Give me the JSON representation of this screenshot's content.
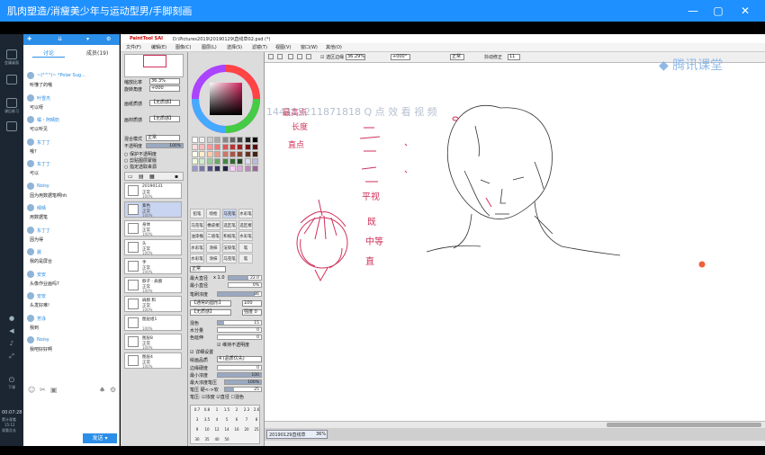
{
  "window": {
    "title": "肌肉塑造/消瘦美少年与运动型男/手脚刻画"
  },
  "sidenav": {
    "items": [
      "会議桌面",
      "",
      "",
      "课后练习",
      "",
      "",
      "",
      "",
      "下课"
    ],
    "time": "00:07:28",
    "time_label": "累计观看",
    "time_sub1": "15:12",
    "time_sub2": "观看总长"
  },
  "chat": {
    "tabs": [
      "讨论",
      "成员(19)"
    ],
    "messages": [
      {
        "name": "~(°^°)~ *Polar Sug...",
        "text": "听懂了的哦"
      },
      {
        "name": "叶雪杰",
        "text": "可以呀"
      },
      {
        "name": "橘・阿晴奶",
        "text": "可以听见"
      },
      {
        "name": "东丁丁",
        "text": "哦?"
      },
      {
        "name": "东丁丁",
        "text": "可以"
      },
      {
        "name": "Noisy",
        "text": "因为用数据笔啊hh"
      },
      {
        "name": "晴晴",
        "text": "用数据笔"
      },
      {
        "name": "东丁丁",
        "text": "因为得"
      },
      {
        "name": "晨",
        "text": "我的是屏台"
      },
      {
        "name": "安安",
        "text": "头像作业画吗?"
      },
      {
        "name": "安安",
        "text": "头发好难!"
      },
      {
        "name": "芳泳",
        "text": "我到"
      },
      {
        "name": "Noisy",
        "text": "我吧好好啊"
      }
    ],
    "send_label": "发送"
  },
  "sai": {
    "app_logo": "PaintTool SAI",
    "file_title": "D:\\Pictures2019\\20190129\\直线草02.psd (*)",
    "menus": [
      "文件(F)",
      "编辑(E)",
      "图像(C)",
      "图层(L)",
      "选择(S)",
      "滤镜(T)",
      "视图(V)",
      "窗口(W)",
      "其他(O)"
    ],
    "toolbar": {
      "anti_alias": "选区边缘",
      "zoom": "36.29%",
      "angle": "+000°",
      "blend": "正常",
      "stabilizer_label": "抖动修正",
      "stabilizer": "11"
    },
    "left": {
      "zoom_label": "缩放比率",
      "zoom_value": "36.3%",
      "angle_label": "旋转角度",
      "angle_value": "+000",
      "paper_label": "画纸质感",
      "paper_value": "【无质感】",
      "paper_strength_label": "画材质感",
      "paper_strength_value": "【无质感】",
      "blend_label": "混合模式",
      "blend_value": "正常",
      "opacity_label": "不透明度",
      "opacity_value": "100%",
      "checks": [
        "保护不透明度",
        "剪贴图层蒙版",
        "指定选取来源"
      ],
      "layers": [
        {
          "name": "20190131",
          "mode": "正常",
          "pct": "100%",
          "folder": true
        },
        {
          "name": "紫色",
          "mode": "正常",
          "pct": "100%"
        },
        {
          "name": "身体",
          "mode": "正常",
          "pct": "100%"
        },
        {
          "name": "头",
          "mode": "正常",
          "pct": "100%"
        },
        {
          "name": "手",
          "mode": "正常",
          "pct": "100%"
        },
        {
          "name": "脖子 · 肩膀",
          "mode": "正常",
          "pct": "100%"
        },
        {
          "name": "肩膀 和",
          "mode": "正常",
          "pct": "100%"
        },
        {
          "name": "图层组1",
          "mode": "",
          "pct": "100%",
          "folder": true
        },
        {
          "name": "图层8",
          "mode": "正常",
          "pct": "100%"
        },
        {
          "name": "图层4",
          "mode": "正常",
          "pct": "100%"
        }
      ]
    },
    "mid": {
      "tools": [
        "铅笔",
        "喷枪",
        "马克笔",
        "水彩笔",
        "马克笔",
        "橡皮擦",
        "选区笔",
        "选区擦",
        "油漆桶",
        "二值笔",
        "和纸笔",
        "水彩笔",
        "水彩笔",
        "涂抹",
        "渲染笔",
        "笔",
        "水彩笔",
        "涂抹",
        "马克笔",
        "笔"
      ],
      "blend_value": "正常",
      "size_label": "最大直径",
      "size_mult": "x 1.0",
      "size_value": "22.0",
      "min_size_label": "最小直径",
      "min_size_value": "0%",
      "density_label": "笔刷浓度",
      "density_value": "86",
      "shape_label": "【通常的圆形】",
      "shape_value": "100",
      "texture_label": "【无质感】",
      "texture_value": "强度 0",
      "mix_label": "混色",
      "mix_value": "15",
      "water_label": "水分量",
      "water_value": "0",
      "color_stretch_label": "色延伸",
      "color_stretch_value": "0",
      "keep_opacity": "维持不透明度",
      "detail_label": "详细设置",
      "quality_label": "绘画品质",
      "quality_value": "4 (品质优先)",
      "edge_label": "边缘硬度",
      "edge_value": "0",
      "min_density_label": "最小浓度",
      "min_density_value": "100",
      "max_pressure_label": "最大浓度笔压",
      "max_pressure_value": "100%",
      "pressure_label": "笔压 硬<->软",
      "pressure_value": "25",
      "pressure_opts": [
        "笔压:",
        "浓度",
        "直径",
        "混色"
      ],
      "brush_sizes": [
        "0.7",
        "0.8",
        "1",
        "1.5",
        "2",
        "2.3",
        "2.6",
        "3",
        "3.5",
        "4",
        "5",
        "6",
        "7",
        "8",
        "9",
        "10",
        "12",
        "14",
        "16",
        "20",
        "25",
        "30",
        "35",
        "40",
        "50"
      ]
    },
    "canvas": {
      "watermark": "144115211871818 Q 点 效 看 视 频",
      "brand": "腾讯课堂",
      "annotations": [
        "最高点",
        "长度",
        "直点",
        "平视",
        "既",
        "中等",
        "直"
      ]
    },
    "tab": {
      "label": "20190129直线草",
      "pct": "36%"
    }
  },
  "colors": {
    "titlebar": "#1e90ff",
    "sidenav": "#1b2632",
    "chat_header": "#2b8ee8",
    "red_ink": "#d0325a",
    "orange_dot": "#f0603c"
  }
}
